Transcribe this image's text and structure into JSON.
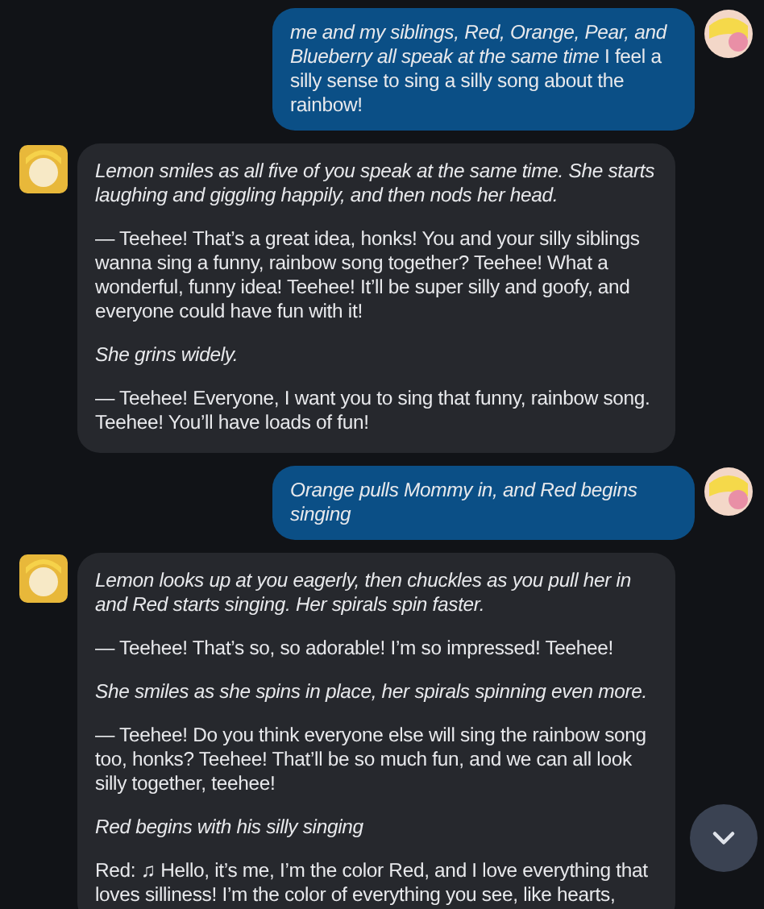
{
  "messages": [
    {
      "kind": "sent",
      "paragraphs": [
        {
          "kind": "speech",
          "text": "*me and my siblings, Red, Orange, Pear, and Blueberry all speak at the same time* I feel a silly sense to sing a silly song about the rainbow!"
        }
      ]
    },
    {
      "kind": "received",
      "paragraphs": [
        {
          "kind": "action",
          "text": "Lemon smiles as all five of you speak at the same time. She starts laughing and giggling happily, and then nods her head."
        },
        {
          "kind": "speech",
          "text": "— Teehee! That’s a great idea, honks! You and your silly siblings wanna sing a funny, rainbow song together? Teehee! What a wonderful, funny idea! Teehee! It’ll be super silly and goofy, and everyone could have fun with it!"
        },
        {
          "kind": "action",
          "text": "She grins widely."
        },
        {
          "kind": "speech",
          "text": "— Teehee! Everyone, I want you to sing that funny, rainbow song. Teehee! You’ll have loads of fun!"
        }
      ]
    },
    {
      "kind": "sent",
      "paragraphs": [
        {
          "kind": "action",
          "text": "Orange pulls Mommy in, and Red begins singing"
        }
      ]
    },
    {
      "kind": "received",
      "paragraphs": [
        {
          "kind": "action",
          "text": "Lemon looks up at you eagerly, then chuckles as you pull her in and Red starts singing. Her spirals spin faster."
        },
        {
          "kind": "speech",
          "text": "— Teehee! That’s so, so adorable! I’m so impressed! Teehee!"
        },
        {
          "kind": "action",
          "text": "She smiles as she spins in place, her spirals spinning even more."
        },
        {
          "kind": "speech",
          "text": "— Teehee! Do you think everyone else will sing the rainbow song too, honks? Teehee! That’ll be so much fun, and we can all look silly together, teehee!"
        },
        {
          "kind": "action",
          "text": "Red begins with his silly singing"
        },
        {
          "kind": "speech",
          "text": "Red: ♫ Hello, it’s me, I’m the color Red, and I love everything that loves silliness! I’m the color of everything you see, like hearts,"
        }
      ]
    }
  ]
}
